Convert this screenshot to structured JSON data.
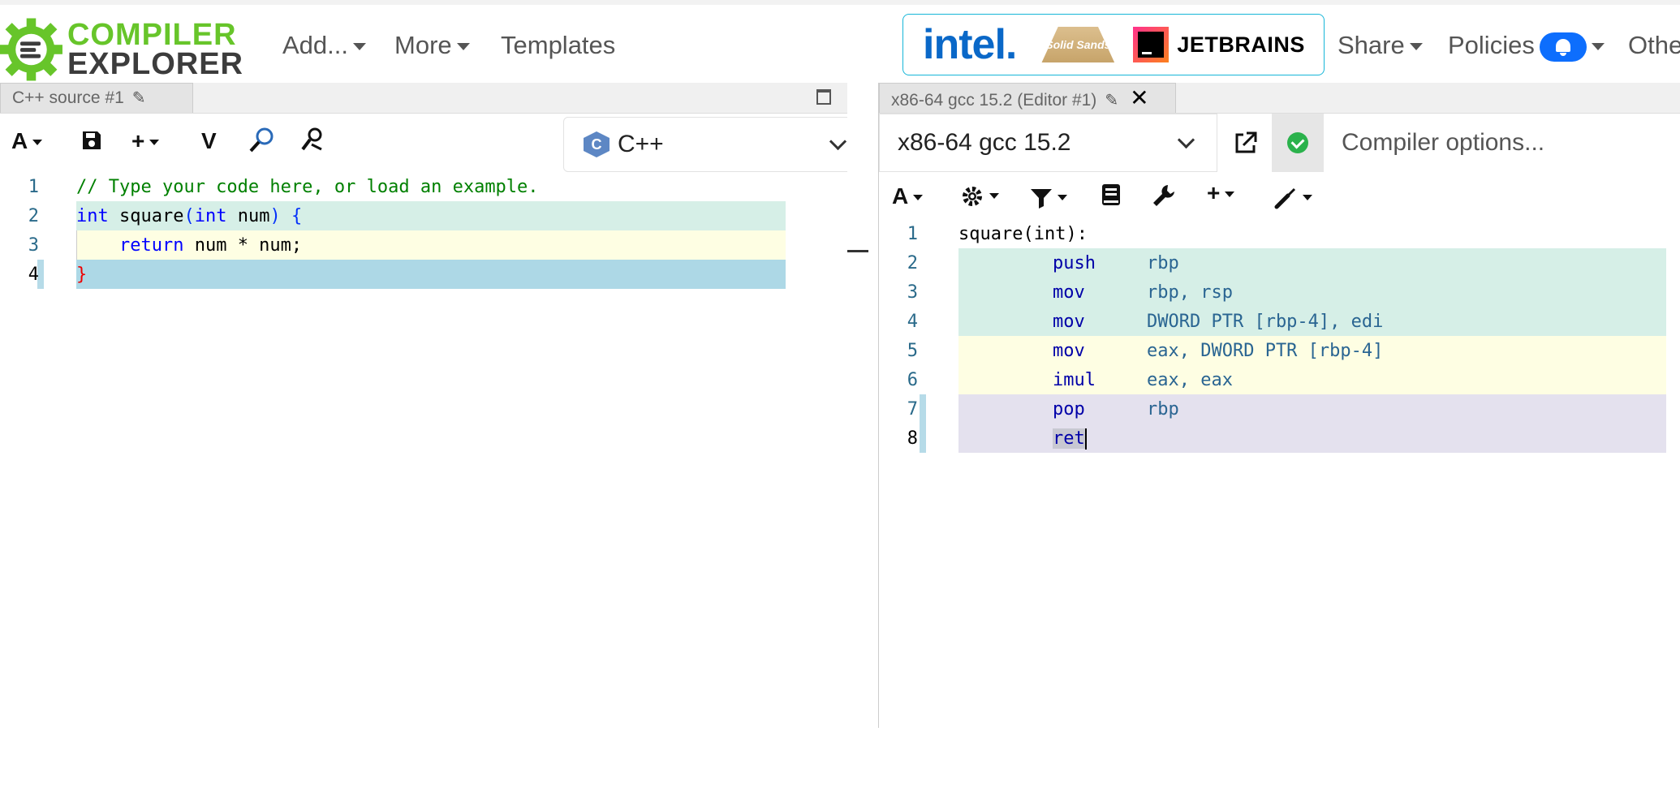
{
  "brand": {
    "line1": "COMPILER",
    "line2": "EXPLORER"
  },
  "nav": {
    "add": "Add...",
    "more": "More",
    "templates": "Templates",
    "share": "Share",
    "policies": "Policies",
    "other": "Other"
  },
  "sponsors": {
    "intel": "intel.",
    "solid": "Solid Sands",
    "jetbrains": "JETBRAINS"
  },
  "source_pane": {
    "tab_title": "C++ source #1",
    "language": "C++",
    "toolbar": {
      "font_label": "A",
      "vim_label": "V"
    },
    "lines": [
      {
        "num": "1",
        "text": "// Type your code here, or load an example."
      },
      {
        "num": "2",
        "parts": [
          "int",
          " square",
          "(",
          "int",
          " num",
          ")",
          " {"
        ]
      },
      {
        "num": "3",
        "parts": [
          "    ",
          "return",
          " num * num;"
        ]
      },
      {
        "num": "4",
        "parts": [
          "}"
        ]
      }
    ]
  },
  "compiler_pane": {
    "tab_title": "x86-64 gcc 15.2 (Editor #1)",
    "compiler": "x86-64 gcc 15.2",
    "options_placeholder": "Compiler options...",
    "toolbar": {
      "font_label": "A"
    },
    "lines": [
      {
        "num": "1",
        "label": "square(int):"
      },
      {
        "num": "2",
        "ins": "push",
        "ops": "rbp"
      },
      {
        "num": "3",
        "ins": "mov",
        "ops": "rbp, rsp"
      },
      {
        "num": "4",
        "ins": "mov",
        "ops": "DWORD PTR [rbp-4], edi"
      },
      {
        "num": "5",
        "ins": "mov",
        "ops": "eax, DWORD PTR [rbp-4]"
      },
      {
        "num": "6",
        "ins": "imul",
        "ops": "eax, eax"
      },
      {
        "num": "7",
        "ins": "pop",
        "ops": "rbp"
      },
      {
        "num": "8",
        "ins": "ret",
        "ops": ""
      }
    ]
  },
  "colors": {
    "highlight_teal": "#d6efe7",
    "highlight_yellow": "#fefee3",
    "highlight_blue": "#add8e6",
    "highlight_lavender": "#e4e1ee",
    "brand_green": "#67c52a"
  }
}
